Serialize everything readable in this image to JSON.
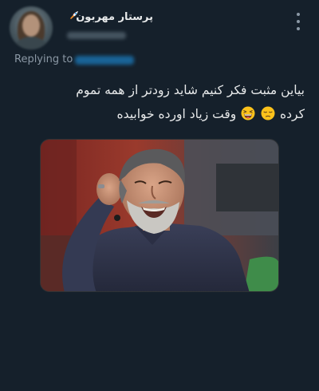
{
  "tweet": {
    "display_name": "پرستار مهربون",
    "name_emoji_icon": "rocket-icon",
    "replying_to_label": "Replying to",
    "text_line_1": "بیاین مثبت فکر کنیم شاید زودتر از همه تموم",
    "text_line_2a": "کرده",
    "text_line_2b": "وقت زیاد اورده خوابیده",
    "emojis": [
      "pensive-face-icon",
      "grinning-squinting-face-icon"
    ],
    "more_icon": "more-vertical-icon"
  },
  "media": {
    "description_icon": "photo-laughing-man",
    "colors": {
      "shirt": "#3a3f58",
      "studio_red": "#8c2a26",
      "sofa_green": "#3f8c4a"
    }
  },
  "theme": {
    "background": "#15202b",
    "text": "#e7e9ea",
    "muted": "#8b98a5",
    "accent": "#1d9bf0"
  }
}
